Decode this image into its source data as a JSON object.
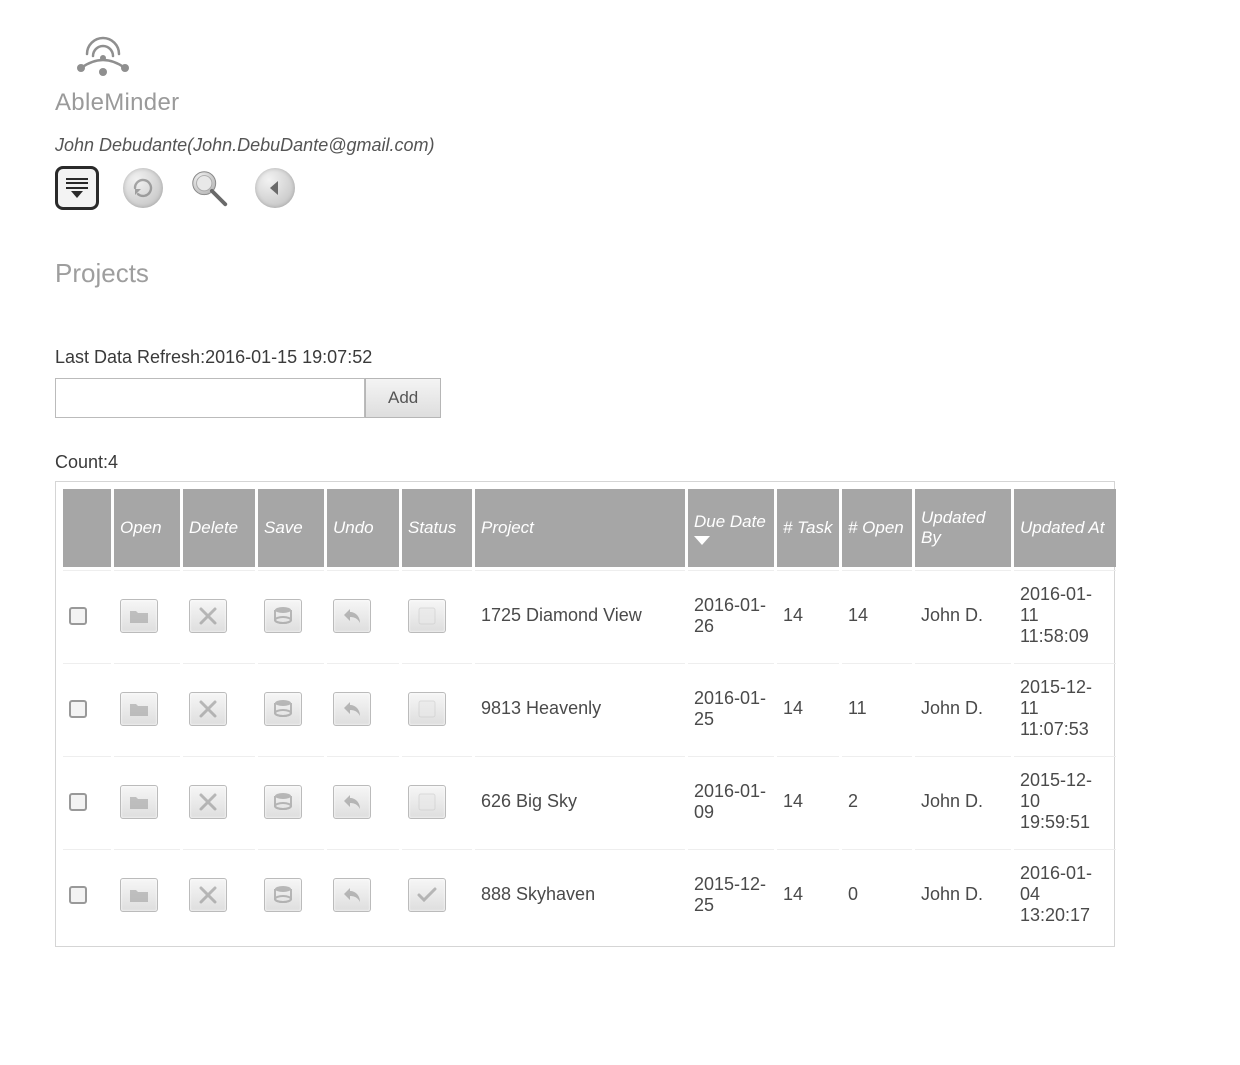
{
  "brand": {
    "name": "AbleMinder"
  },
  "user": {
    "display": "John Debudante(John.DebuDante@gmail.com)"
  },
  "section_title": "Projects",
  "refresh": {
    "label": "Last Data Refresh:",
    "value": "2016-01-15 19:07:52"
  },
  "add": {
    "button_label": "Add",
    "input_value": ""
  },
  "count": {
    "label": "Count:",
    "value": "4"
  },
  "columns": {
    "checkbox": "",
    "open": "Open",
    "delete": "Delete",
    "save": "Save",
    "undo": "Undo",
    "status": "Status",
    "project": "Project",
    "due": "Due Date",
    "tasks": "# Task",
    "openc": "# Open",
    "by": "Updated By",
    "at": "Updated At"
  },
  "sort": {
    "column": "due",
    "direction": "desc"
  },
  "rows": [
    {
      "project": "1725 Diamond View",
      "due": "2016-01-26",
      "tasks": "14",
      "open": "14",
      "by": "John D.",
      "at": "2016-01-11 11:58:09",
      "status_done": false
    },
    {
      "project": "9813 Heavenly",
      "due": "2016-01-25",
      "tasks": "14",
      "open": "11",
      "by": "John D.",
      "at": "2015-12-11 11:07:53",
      "status_done": false
    },
    {
      "project": "626 Big Sky",
      "due": "2016-01-09",
      "tasks": "14",
      "open": "2",
      "by": "John D.",
      "at": "2015-12-10 19:59:51",
      "status_done": false
    },
    {
      "project": "888 Skyhaven",
      "due": "2015-12-25",
      "tasks": "14",
      "open": "0",
      "by": "John D.",
      "at": "2016-01-04 13:20:17",
      "status_done": true
    }
  ]
}
